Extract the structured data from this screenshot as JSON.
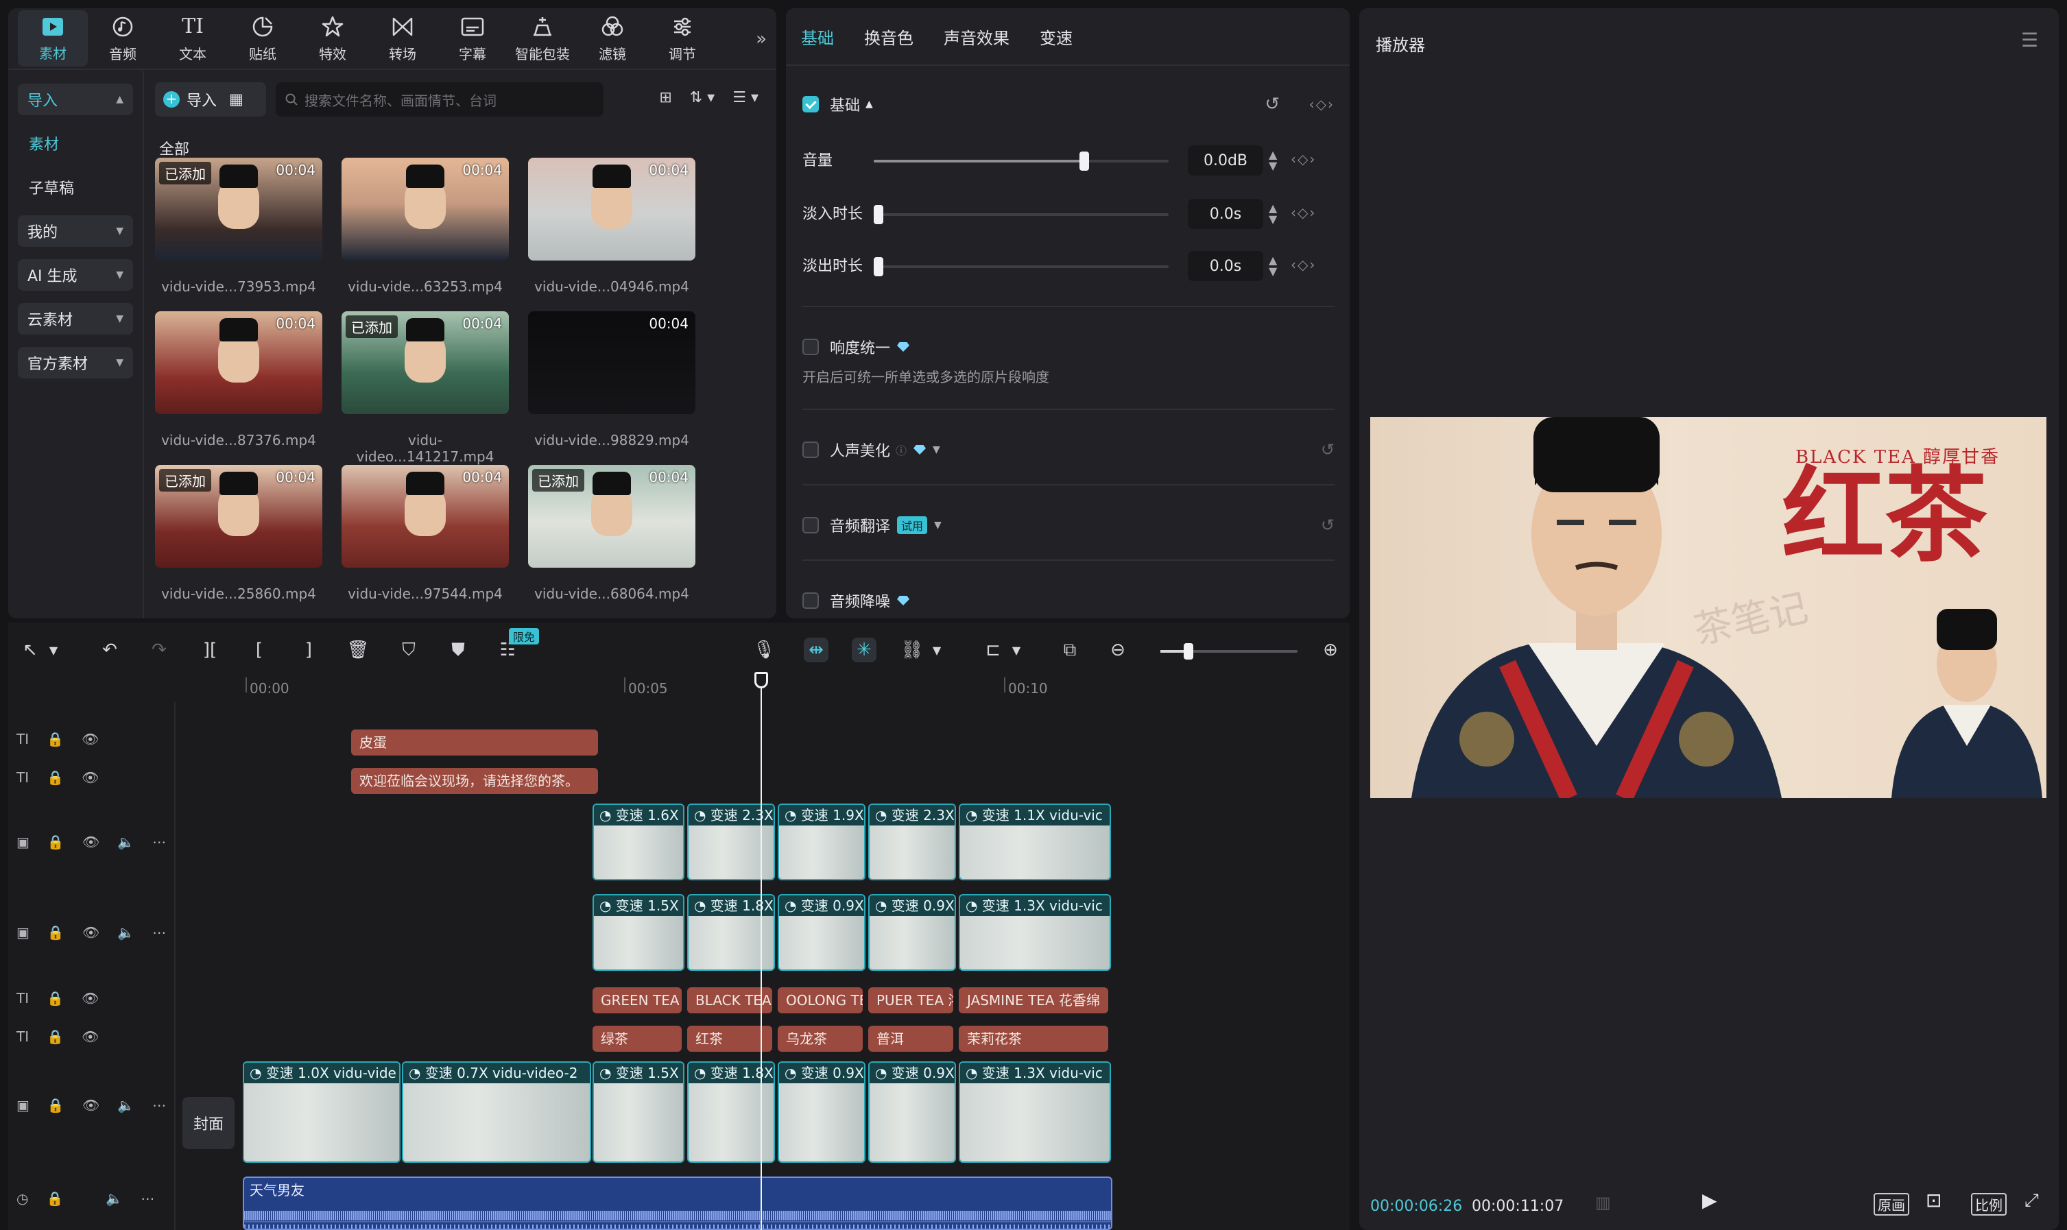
{
  "media_tabs": [
    {
      "label": "素材",
      "icon": "media-icon",
      "active": true
    },
    {
      "label": "音频",
      "icon": "audio-icon"
    },
    {
      "label": "文本",
      "icon": "text-icon"
    },
    {
      "label": "贴纸",
      "icon": "sticker-icon"
    },
    {
      "label": "特效",
      "icon": "effects-icon"
    },
    {
      "label": "转场",
      "icon": "transition-icon"
    },
    {
      "label": "字幕",
      "icon": "caption-icon"
    },
    {
      "label": "智能包装",
      "icon": "smart-pack-icon"
    },
    {
      "label": "滤镜",
      "icon": "filter-icon"
    },
    {
      "label": "调节",
      "icon": "adjust-icon"
    }
  ],
  "left_nav": {
    "import": "导入",
    "material": "素材",
    "draft": "子草稿",
    "mine": "我的",
    "ai": "AI 生成",
    "cloud": "云素材",
    "official": "官方素材"
  },
  "media_toolbar": {
    "import": "导入",
    "search_placeholder": "搜索文件名称、画面情节、台词",
    "section": "全部"
  },
  "media_items": [
    {
      "name": "vidu-vide...73953.mp4",
      "duration": "00:04",
      "added": "已添加"
    },
    {
      "name": "vidu-vide...63253.mp4",
      "duration": "00:04",
      "added": ""
    },
    {
      "name": "vidu-vide...04946.mp4",
      "duration": "00:04",
      "added": ""
    },
    {
      "name": "vidu-vide...87376.mp4",
      "duration": "00:04",
      "added": ""
    },
    {
      "name": "vidu-video...141217.mp4",
      "duration": "00:04",
      "added": "已添加"
    },
    {
      "name": "vidu-vide...98829.mp4",
      "duration": "00:04",
      "added": ""
    },
    {
      "name": "vidu-vide...25860.mp4",
      "duration": "00:04",
      "added": "已添加"
    },
    {
      "name": "vidu-vide...97544.mp4",
      "duration": "00:04",
      "added": ""
    },
    {
      "name": "vidu-vide...68064.mp4",
      "duration": "00:04",
      "added": "已添加"
    }
  ],
  "props": {
    "tabs": [
      "基础",
      "换音色",
      "声音效果",
      "变速"
    ],
    "basic": "基础",
    "volume_label": "音量",
    "volume_value": "0.0dB",
    "fadein_label": "淡入时长",
    "fadein_value": "0.0s",
    "fadeout_label": "淡出时长",
    "fadeout_value": "0.0s",
    "loudness": "响度统一",
    "loudness_desc": "开启后可统一所单选或多选的原片段响度",
    "voice_beauty": "人声美化",
    "translate": "音频翻译",
    "trial": "试用",
    "denoise": "音频降噪"
  },
  "player": {
    "title": "播放器",
    "current_time": "00:00:06:26",
    "total_time": "00:00:11:07",
    "btn_original": "原画",
    "btn_ratio": "比例",
    "poster_en": "BLACK TEA 醇厚甘香",
    "poster_cn": "红茶",
    "watermark": "茶笔记"
  },
  "toolbar": {
    "free_badge": "限免"
  },
  "timeline": {
    "ruler": [
      "00:00",
      "00:05",
      "00:10"
    ],
    "text_track1": [
      "皮蛋"
    ],
    "text_track2": [
      "欢迎莅临会议现场，请选择您的茶。"
    ],
    "video1": [
      "变速 1.6X",
      "变速 2.3X",
      "变速 1.9X",
      "变速 2.3X",
      "变速 1.1X  vidu-vic"
    ],
    "video2": [
      "变速 1.5X",
      "变速 1.8X",
      "变速 0.9X",
      "变速 0.9X",
      "变速 1.3X  vidu-vic"
    ],
    "text_en": [
      "GREEN TEA",
      "BLACK TEA",
      "OOLONG TE",
      "PUER TEA 浓",
      "JASMINE TEA  花香绵"
    ],
    "text_cn": [
      "绿茶",
      "红茶",
      "乌龙茶",
      "普洱",
      "茉莉花茶"
    ],
    "main": [
      "变速 1.0X  vidu-vide",
      "变速 0.7X  vidu-video-2",
      "变速 1.5X",
      "变速 1.8X",
      "变速 0.9X",
      "变速 0.9X",
      "变速 1.3X  vidu-vic"
    ],
    "cover": "封面",
    "audio": "天气男友"
  },
  "colors": {
    "accent": "#4fc9d9",
    "text_clip": "#9b4a3f",
    "video_clip": "#1e5d63",
    "audio_clip": "#233f86"
  }
}
